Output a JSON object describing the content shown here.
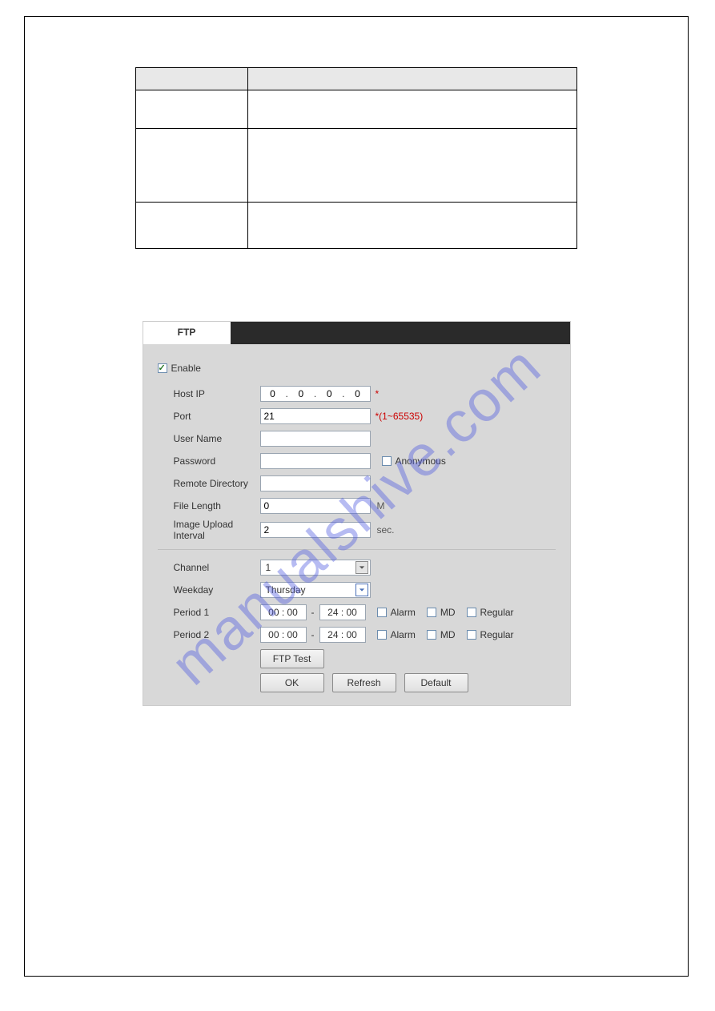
{
  "watermark": "manualshive.com",
  "table": {
    "headers": [
      "",
      ""
    ],
    "rows": [
      {
        "col1": "",
        "col2": "",
        "cls": "r1"
      },
      {
        "col1": "",
        "col2": "",
        "cls": "r2"
      },
      {
        "col1": "",
        "col2": "",
        "cls": "r3"
      }
    ]
  },
  "ftp": {
    "tab_label": "FTP",
    "enable_label": "Enable",
    "enable_checked": true,
    "hostip_label": "Host IP",
    "hostip": [
      "0",
      "0",
      "0",
      "0"
    ],
    "hostip_required": "*",
    "port_label": "Port",
    "port_value": "21",
    "port_hint": "*(1~65535)",
    "username_label": "User Name",
    "username_value": "",
    "password_label": "Password",
    "password_value": "",
    "anonymous_label": "Anonymous",
    "anonymous_checked": false,
    "remotedir_label": "Remote Directory",
    "remotedir_value": "",
    "filelength_label": "File Length",
    "filelength_value": "0",
    "filelength_unit": "M",
    "imgupload_label": "Image Upload Interval",
    "imgupload_value": "2",
    "imgupload_unit": "sec.",
    "channel_label": "Channel",
    "channel_value": "1",
    "weekday_label": "Weekday",
    "weekday_value": "Thursday",
    "period1_label": "Period 1",
    "period2_label": "Period 2",
    "p1_start": "00 : 00",
    "p1_end": "24 : 00",
    "p2_start": "00 : 00",
    "p2_end": "24 : 00",
    "alarm_label": "Alarm",
    "md_label": "MD",
    "regular_label": "Regular",
    "ftptest_label": "FTP Test",
    "ok_label": "OK",
    "refresh_label": "Refresh",
    "default_label": "Default"
  }
}
